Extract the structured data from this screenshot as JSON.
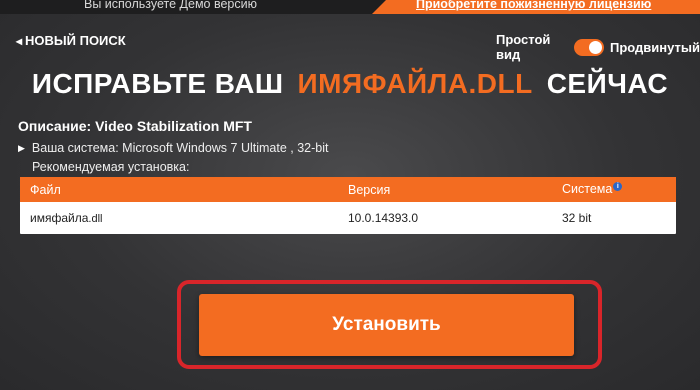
{
  "topbar": {
    "demo_text": "Вы используете Демо версию",
    "buy_link": "Приобретите пожизненную лицензию"
  },
  "nav": {
    "back_label": "НОВЫЙ ПОИСК",
    "simple_view": "Простой вид",
    "advanced_view": "Продвинутый"
  },
  "headline": {
    "part1": "ИСПРАВЬТЕ ВАШ",
    "accent": "ИМЯФАЙЛА.DLL",
    "part2": "СЕЙЧАС"
  },
  "details": {
    "description": "Описание: Video Stabilization MFT",
    "system": "Ваша система: Microsoft Windows 7 Ultimate , 32-bit",
    "recommended": "Рекомендуемая установка:"
  },
  "table": {
    "headers": [
      "Файл",
      "Версия",
      "Система"
    ],
    "rows": [
      {
        "file_name": "имяфайла",
        "file_ext": ".dll",
        "version": "10.0.14393.0",
        "system": "32 bit"
      }
    ]
  },
  "install_button": "Установить",
  "colors": {
    "accent": "#f36c21",
    "highlight_frame": "#d9252a",
    "background": "#3a3a3c"
  }
}
